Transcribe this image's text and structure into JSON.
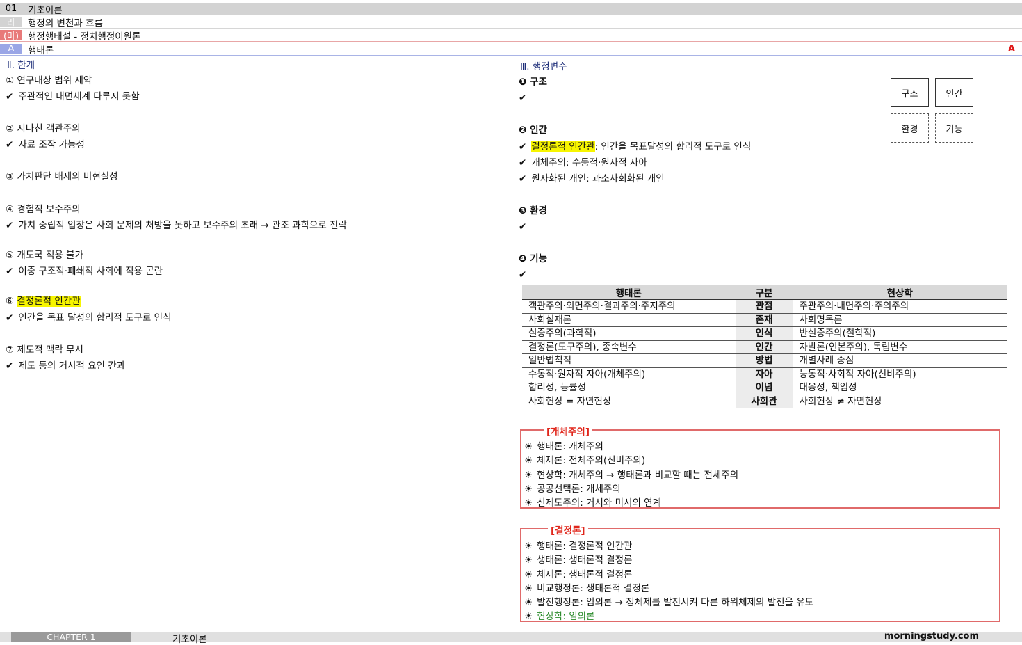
{
  "headers": [
    {
      "tag": "01",
      "title": "기초이론"
    },
    {
      "tag": "라",
      "title": "행정의 변천과 흐름"
    },
    {
      "tag": "(마)",
      "title": "행정행태설 - 정치행정이원론"
    },
    {
      "tag": "A",
      "title": "행태론",
      "right": "A"
    }
  ],
  "left": {
    "section": "Ⅱ. 한계",
    "items": [
      {
        "head": "① 연구대상 범위 제약",
        "check": "✔",
        "body": "주관적인 내면세계 다루지 못함"
      },
      {
        "head": "② 지나친 객관주의",
        "check": "✔",
        "body": "자료 조작 가능성"
      },
      {
        "head": "③ 가치판단 배제의 비현실성"
      },
      {
        "head": "④ 경험적 보수주의",
        "check": "✔",
        "body": "가치 중립적 입장은 사회 문제의 처방을 못하고 보수주의 초래 → 관조 과학으로 전락"
      },
      {
        "head": "⑤ 개도국 적용 불가",
        "check": "✔",
        "body": "이중 구조적·폐쇄적 사회에 적용 곤란"
      },
      {
        "head_num": "⑥",
        "head_hl": "결정론적 인간관",
        "check": "✔",
        "body": "인간을 목표 달성의 합리적 도구로 인식"
      },
      {
        "head": "⑦ 제도적 맥락 무시",
        "check": "✔",
        "body": "제도 등의 거시적 요인 간과"
      }
    ]
  },
  "right": {
    "section": "Ⅲ. 행정변수",
    "variables": [
      {
        "head": "❶ 구조",
        "lines": [
          {
            "check": "✔"
          }
        ]
      },
      {
        "head": "❷ 인간",
        "lines": [
          {
            "check": "✔",
            "hl": "결정론적 인간관",
            "text": ": 인간을 목표달성의 합리적 도구로 인식"
          },
          {
            "check": "✔",
            "text": "개체주의: 수동적·원자적 자아"
          },
          {
            "check": "✔",
            "text": "원자화된 개인: 과소사회화된 개인"
          }
        ]
      },
      {
        "head": "❸ 환경",
        "lines": [
          {
            "check": "✔"
          }
        ]
      },
      {
        "head": "❹ 기능",
        "lines": [
          {
            "check": "✔"
          }
        ]
      }
    ],
    "boxes": [
      "구조",
      "인간",
      "환경",
      "기능"
    ]
  },
  "table": {
    "headers": [
      "행태론",
      "구분",
      "현상학"
    ],
    "rows": [
      [
        "객관주의·외면주의·결과주의·주지주의",
        "관점",
        "주관주의·내면주의·주의주의"
      ],
      [
        "사회실재론",
        "존재",
        "사회명목론"
      ],
      [
        "실증주의(과학적)",
        "인식",
        "반실증주의(철학적)"
      ],
      [
        "결정론(도구주의), 종속변수",
        "인간",
        "자발론(인본주의), 독립변수"
      ],
      [
        "일반법칙적",
        "방법",
        "개별사례 중심"
      ],
      [
        "수동적·원자적 자아(개체주의)",
        "자아",
        "능동적·사회적 자아(신비주의)"
      ],
      [
        "합리성, 능률성",
        "이념",
        "대응성, 책임성"
      ],
      [
        "사회현상 = 자연현상",
        "사회관",
        "사회현상 ≠ 자연현상"
      ]
    ]
  },
  "box1": {
    "label": "[개체주의]",
    "icon": "☀",
    "items": [
      "행태론: 개체주의",
      "체제론: 전체주의(신비주의)",
      "현상학: 개체주의 → 행태론과 비교할 때는 전체주의",
      "공공선택론: 개체주의",
      "신제도주의: 거시와 미시의 연계"
    ]
  },
  "box2": {
    "label": "[결정론]",
    "icon": "☀",
    "items": [
      "행태론: 결정론적 인간관",
      "생태론: 생태론적 결정론",
      "체제론: 생태론적 결정론",
      "비교행정론: 생태론적 결정론",
      "발전행정론: 임의론 → 정체제를 발전시켜 다른 하위체제의 발전을 유도"
    ],
    "green_item": "현상학: 임의론",
    "green_color": "#2a8a2a"
  },
  "footer": {
    "chapter": "CHAPTER 1",
    "title": "기초이론",
    "site": "morningstudy.com"
  }
}
